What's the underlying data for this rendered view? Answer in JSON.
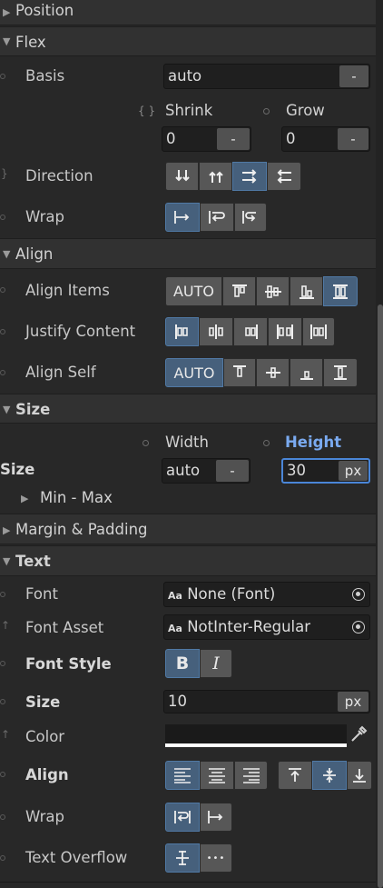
{
  "position": {
    "title": "Position"
  },
  "flex": {
    "title": "Flex",
    "basis": {
      "label": "Basis",
      "value": "auto",
      "unit": "-"
    },
    "shrink": {
      "label": "Shrink",
      "value": "0",
      "unit": "-"
    },
    "grow": {
      "label": "Grow",
      "value": "0",
      "unit": "-"
    },
    "direction": {
      "label": "Direction"
    },
    "wrap": {
      "label": "Wrap"
    }
  },
  "align": {
    "title": "Align",
    "align_items": {
      "label": "Align Items",
      "auto": "AUTO"
    },
    "justify_content": {
      "label": "Justify Content"
    },
    "align_self": {
      "label": "Align Self",
      "auto": "AUTO"
    }
  },
  "size": {
    "title": "Size",
    "width_label": "Width",
    "height_label": "Height",
    "row_label": "Size",
    "width": {
      "value": "auto",
      "unit": "-"
    },
    "height": {
      "value": "30",
      "unit": "px"
    },
    "minmax": "Min - Max"
  },
  "margin_padding": {
    "title": "Margin & Padding"
  },
  "text": {
    "title": "Text",
    "font": {
      "label": "Font",
      "value": "None (Font)",
      "prefix": "Aa"
    },
    "font_asset": {
      "label": "Font Asset",
      "value": "NotInter-Regular",
      "prefix": "Aa"
    },
    "font_style": {
      "label": "Font Style",
      "bold": "B",
      "italic": "I"
    },
    "size": {
      "label": "Size",
      "value": "10",
      "unit": "px"
    },
    "color": {
      "label": "Color",
      "value": "#1a1a1a"
    },
    "align": {
      "label": "Align"
    },
    "wrap": {
      "label": "Wrap"
    },
    "text_overflow": {
      "label": "Text Overflow",
      "ellipsis": "•••"
    }
  },
  "colors": {
    "accent": "#46607c",
    "accent_text": "#7aaaf0",
    "background": "#282828",
    "header": "#313131"
  }
}
